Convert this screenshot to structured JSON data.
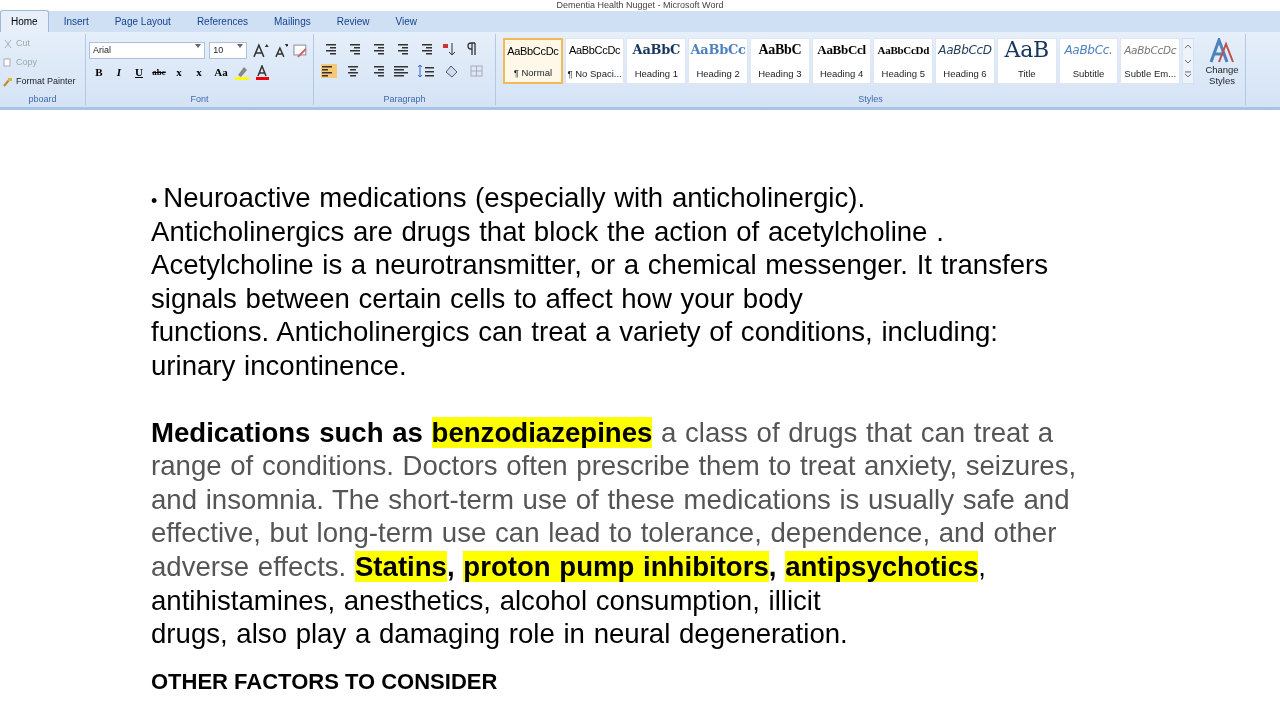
{
  "window": {
    "title": "Dementia Health Nugget - Microsoft Word"
  },
  "tabs": [
    {
      "label": "Home",
      "selected": true
    },
    {
      "label": "Insert",
      "selected": false
    },
    {
      "label": "Page Layout",
      "selected": false
    },
    {
      "label": "References",
      "selected": false
    },
    {
      "label": "Mailings",
      "selected": false
    },
    {
      "label": "Review",
      "selected": false
    },
    {
      "label": "View",
      "selected": false
    }
  ],
  "clipboard": {
    "items": [
      {
        "label": "Cut",
        "disabled": true
      },
      {
        "label": "Copy",
        "disabled": true
      },
      {
        "label": "Format Painter",
        "disabled": false
      }
    ],
    "group_label": "pboard"
  },
  "font": {
    "name": "Arial",
    "size": "10",
    "format_buttons": [
      "B",
      "I",
      "U",
      "abc",
      "x",
      "x",
      "Aa"
    ],
    "group_label": "Font"
  },
  "paragraph": {
    "group_label": "Paragraph"
  },
  "styles": {
    "items": [
      {
        "preview": "AaBbCcDc",
        "label": "¶ Normal",
        "selected": true
      },
      {
        "preview": "AaBbCcDc",
        "label": "¶ No Spaci...",
        "selected": false
      },
      {
        "preview": "AaBbC",
        "label": "Heading 1",
        "selected": false
      },
      {
        "preview": "AaBbCc",
        "label": "Heading 2",
        "selected": false
      },
      {
        "preview": "AaBbC",
        "label": "Heading 3",
        "selected": false
      },
      {
        "preview": "AaBbCcl",
        "label": "Heading 4",
        "selected": false
      },
      {
        "preview": "AaBbCcDd",
        "label": "Heading 5",
        "selected": false
      },
      {
        "preview": "AaBbCcD",
        "label": "Heading 6",
        "selected": false
      },
      {
        "preview": "AaB",
        "label": "Title",
        "selected": false
      },
      {
        "preview": "AaBbCc.",
        "label": "Subtitle",
        "selected": false
      },
      {
        "preview": "AaBbCcDc",
        "label": "Subtle Em...",
        "selected": false
      }
    ],
    "change_styles": "Change Styles",
    "group_label": "Styles"
  },
  "document": {
    "paragraphs": [
      {
        "bullet": "•",
        "lines": [
          [
            {
              "text": "Neuroactive medications (especially with anticholinergic).",
              "bold": false,
              "highlight": false,
              "muted": false
            }
          ],
          [
            {
              "text": "Anticholinergics are drugs that block the action of acetylcholine .",
              "bold": false,
              "highlight": false,
              "muted": false
            }
          ],
          [
            {
              "text": "Acetylcholine is a neurotransmitter, or a chemical messenger. It transfers",
              "bold": false,
              "highlight": false,
              "muted": false
            }
          ],
          [
            {
              "text": "signals between certain cells to affect how your body",
              "bold": false,
              "highlight": false,
              "muted": false
            }
          ],
          [
            {
              "text": "functions. Anticholinergics can treat a variety of conditions, including:",
              "bold": false,
              "highlight": false,
              "muted": false
            }
          ],
          [
            {
              "text": "urinary incontinence.",
              "bold": false,
              "highlight": false,
              "muted": false
            }
          ]
        ]
      },
      {
        "lines": [
          [
            {
              "text": "Medications such as ",
              "bold": true,
              "highlight": false,
              "muted": false
            },
            {
              "text": "benzodiazepines",
              "bold": true,
              "highlight": true,
              "muted": false
            },
            {
              "text": " a class of drugs that can treat a",
              "bold": false,
              "highlight": false,
              "muted": true
            }
          ],
          [
            {
              "text": "range of conditions. Doctors often prescribe them to treat anxiety, seizures,",
              "bold": false,
              "highlight": false,
              "muted": true
            }
          ],
          [
            {
              "text": "and insomnia. The short-term use of these medications is usually safe and",
              "bold": false,
              "highlight": false,
              "muted": true
            }
          ],
          [
            {
              "text": "effective, but long-term use can lead to tolerance, dependence, and other",
              "bold": false,
              "highlight": false,
              "muted": true
            }
          ],
          [
            {
              "text": "adverse effects. ",
              "bold": false,
              "highlight": false,
              "muted": true
            },
            {
              "text": "Statins",
              "bold": true,
              "highlight": true,
              "muted": false
            },
            {
              "text": ", ",
              "bold": true,
              "highlight": false,
              "muted": false
            },
            {
              "text": "proton pump inhibitors",
              "bold": true,
              "highlight": true,
              "muted": false
            },
            {
              "text": ", ",
              "bold": true,
              "highlight": false,
              "muted": false
            },
            {
              "text": "antipsychotics",
              "bold": true,
              "highlight": true,
              "muted": false
            },
            {
              "text": ",",
              "bold": false,
              "highlight": false,
              "muted": false
            }
          ],
          [
            {
              "text": "antihistamines, anesthetics, alcohol consumption, illicit",
              "bold": false,
              "highlight": false,
              "muted": false
            }
          ],
          [
            {
              "text": "drugs, also play a damaging role in neural degeneration.",
              "bold": false,
              "highlight": false,
              "muted": false
            }
          ]
        ]
      },
      {
        "heading": "OTHER FACTORS TO CONSIDER"
      }
    ]
  }
}
